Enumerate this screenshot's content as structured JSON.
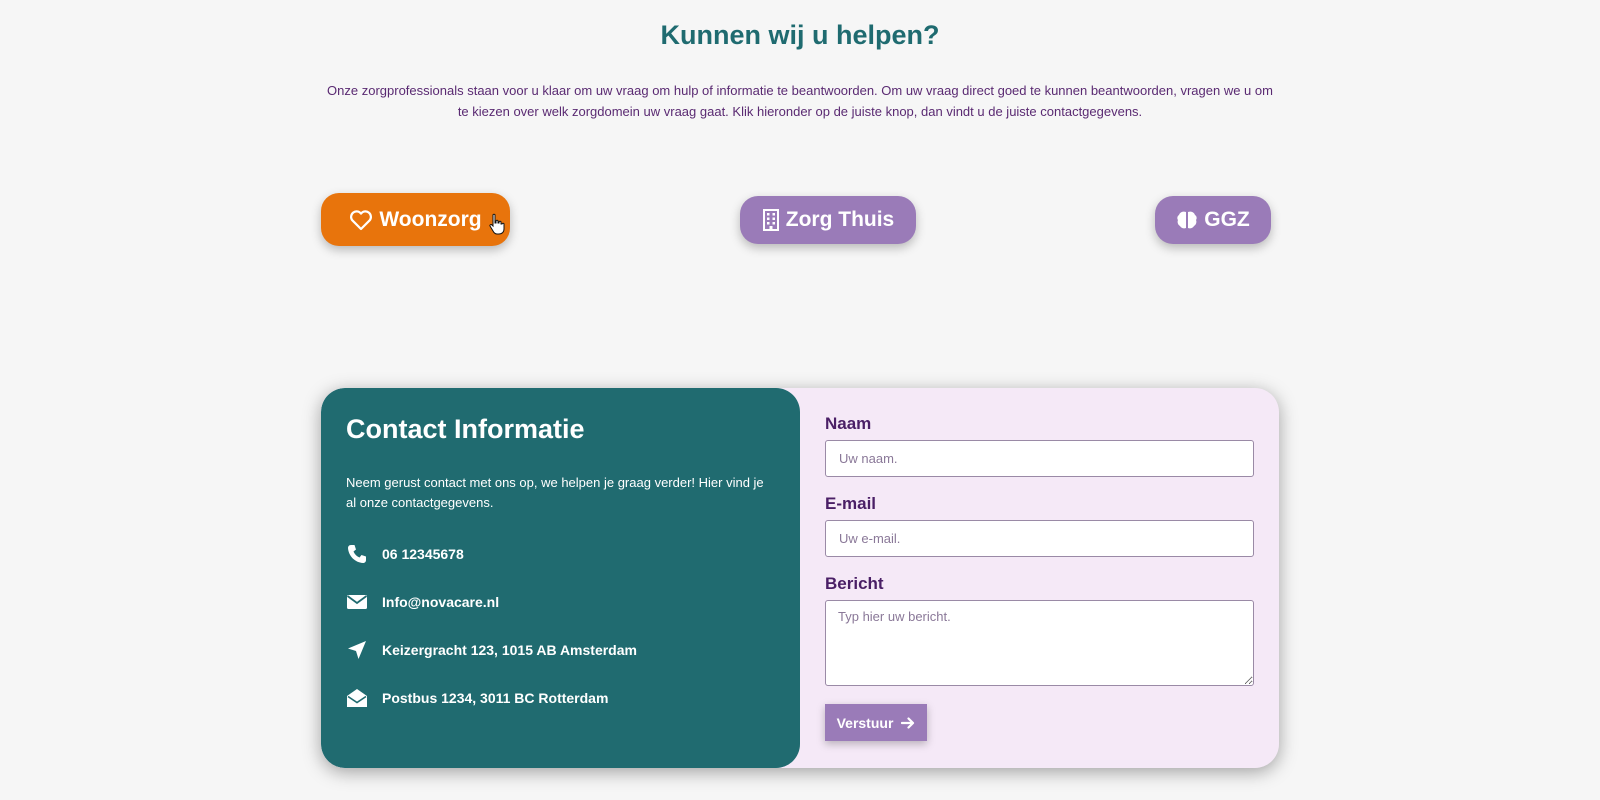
{
  "header": {
    "title": "Kunnen wij u helpen?",
    "intro": "Onze zorgprofessionals staan voor u klaar om uw vraag om hulp of informatie te beantwoorden. Om uw vraag direct goed te kunnen beantwoorden, vragen we u om te kiezen over welk zorgdomein uw vraag gaat. Klik hieronder op de juiste knop, dan vindt u de juiste contactgegevens."
  },
  "domains": [
    {
      "label": "Woonzorg",
      "icon": "heart-icon",
      "color": "#e8740c",
      "active": true
    },
    {
      "label": "Zorg Thuis",
      "icon": "building-icon",
      "color": "#9a7bb8",
      "active": false
    },
    {
      "label": "GGZ",
      "icon": "brain-icon",
      "color": "#9a7bb8",
      "active": false
    }
  ],
  "contact_info": {
    "title": "Contact Informatie",
    "text": "Neem gerust contact met ons op, we helpen je graag verder! Hier vind je al onze contactgegevens.",
    "phone": "06 12345678",
    "email": "Info@novacare.nl",
    "address": "Keizergracht 123, 1015 AB Amsterdam",
    "postbus": "Postbus 1234, 3011 BC Rotterdam",
    "panel_color": "#206b70"
  },
  "form": {
    "name_label": "Naam",
    "name_placeholder": "Uw naam.",
    "email_label": "E-mail",
    "email_placeholder": "Uw e-mail.",
    "message_label": "Bericht",
    "message_placeholder": "Typ hier uw bericht.",
    "submit_label": "Verstuur",
    "background": "#f5e9f7"
  }
}
